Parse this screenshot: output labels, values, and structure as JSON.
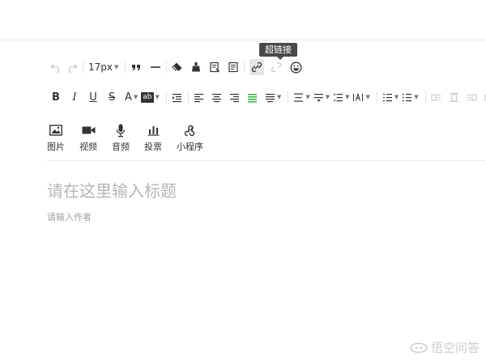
{
  "editor": {
    "tooltip": "超链接",
    "toolbar": {
      "font_size": "17px",
      "bold": "B",
      "italic": "I",
      "underline": "U",
      "strikethrough": "S",
      "font_color": "A",
      "highlight": "ab"
    },
    "media": [
      {
        "label": "图片",
        "icon": "image-icon"
      },
      {
        "label": "视频",
        "icon": "video-icon"
      },
      {
        "label": "音频",
        "icon": "microphone-icon"
      },
      {
        "label": "投票",
        "icon": "bar-chart-icon"
      },
      {
        "label": "小程序",
        "icon": "mini-program-icon"
      }
    ],
    "title_placeholder": "请在这里输入标题",
    "author_placeholder": "请输入作者"
  },
  "watermark": {
    "text": "悟空问答"
  },
  "colors": {
    "active_alignment": "#43b24a",
    "tooltip_bg": "#4a4a4a"
  }
}
